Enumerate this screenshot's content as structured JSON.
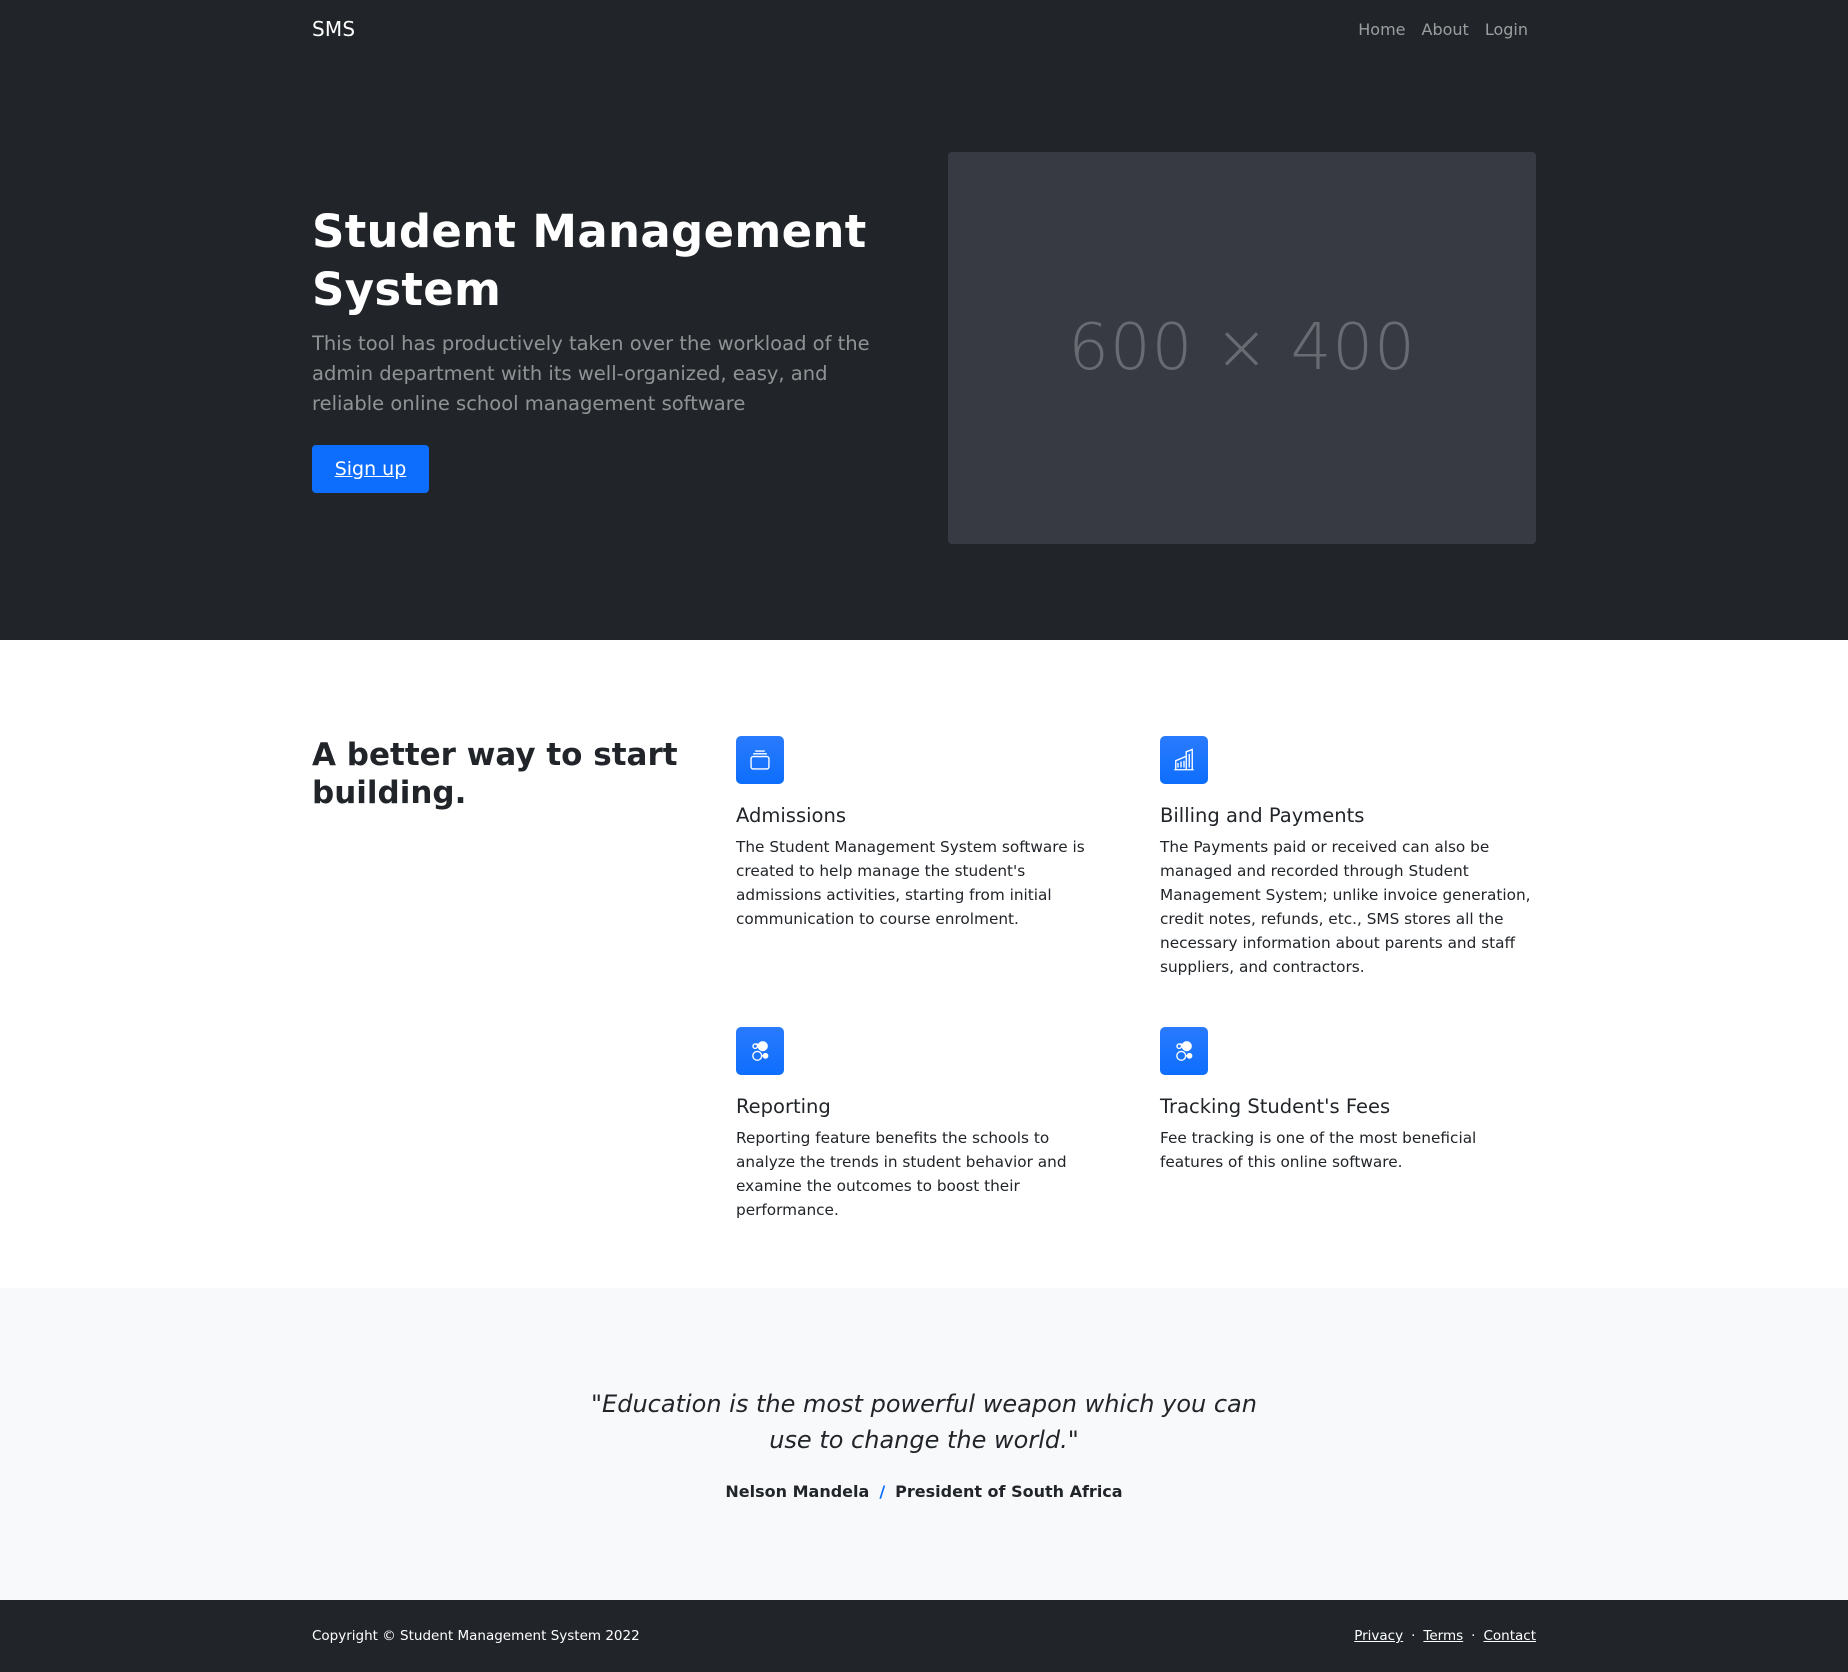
{
  "navbar": {
    "brand": "SMS",
    "links": [
      "Home",
      "About",
      "Login"
    ]
  },
  "hero": {
    "title": "Student Management System",
    "lead": "This tool has productively taken over the workload of the admin department with its well-organized, easy, and reliable online school management software",
    "cta_label": "Sign up",
    "image_placeholder": "600 × 400"
  },
  "features": {
    "heading": "A better way to start building.",
    "items": [
      {
        "icon": "collection-icon",
        "title": "Admissions",
        "text": "The Student Management System software is created to help manage the student's admissions activities, starting from initial communication to course enrolment."
      },
      {
        "icon": "building-icon",
        "title": "Billing and Payments",
        "text": "The Payments paid or received can also be managed and recorded through Student Management System; unlike invoice generation, credit notes, refunds, etc., SMS stores all the necessary information about parents and staff suppliers, and contractors."
      },
      {
        "icon": "toggles-icon",
        "title": "Reporting",
        "text": "Reporting feature benefits the schools to analyze the trends in student behavior and examine the outcomes to boost their performance."
      },
      {
        "icon": "toggles-icon",
        "title": "Tracking Student's Fees",
        "text": "Fee tracking is one of the most beneficial features of this online software."
      }
    ]
  },
  "testimonial": {
    "quote": "\"Education is the most powerful weapon which you can use to change the world.\"",
    "author": "Nelson Mandela",
    "separator": "/",
    "role": "President of South Africa"
  },
  "footer": {
    "copyright": "Copyright © Student Management System 2022",
    "links": [
      "Privacy",
      "Terms",
      "Contact"
    ],
    "separator": "·"
  },
  "colors": {
    "dark_bg": "#212529",
    "primary": "#0d6efd",
    "light_bg": "#f8f9fa"
  }
}
